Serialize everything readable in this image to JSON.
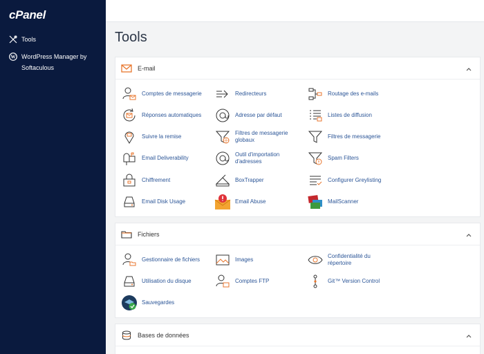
{
  "app": {
    "logo": "cPanel"
  },
  "sidebar": {
    "items": [
      {
        "label": "Tools"
      },
      {
        "label": "WordPress Manager by Softaculous"
      }
    ]
  },
  "page": {
    "title": "Tools"
  },
  "sections": {
    "email": {
      "title": "E-mail",
      "items": [
        "Comptes de messagerie",
        "Redirecteurs",
        "Routage des e-mails",
        "Réponses automatiques",
        "Adresse par défaut",
        "Listes de diffusion",
        "Suivre la remise",
        "Filtres de messagerie globaux",
        "Filtres de messagerie",
        "Email Deliverability",
        "Outil d'importation d'adresses",
        "Spam Filters",
        "Chiffrement",
        "BoxTrapper",
        "Configurer Greylisting",
        "Email Disk Usage",
        "Email Abuse",
        "MailScanner"
      ]
    },
    "files": {
      "title": "Fichiers",
      "items": [
        "Gestionnaire de fichiers",
        "Images",
        "Confidentialité du répertoire",
        "Utilisation du disque",
        "Comptes FTP",
        "Git™ Version Control",
        "Sauvegardes"
      ]
    },
    "databases": {
      "title": "Bases de données"
    }
  },
  "colors": {
    "sidebar": "#0a1a3e",
    "link": "#2b5597",
    "accent": "#e8762d"
  }
}
